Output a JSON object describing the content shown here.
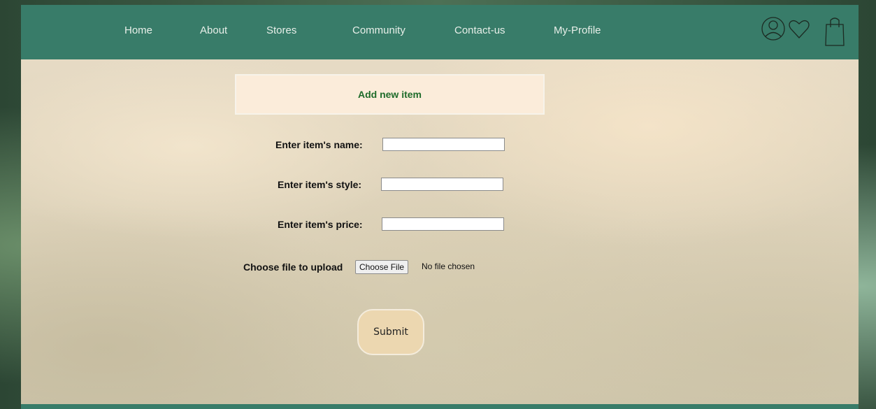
{
  "nav": {
    "links": [
      {
        "label": "Home"
      },
      {
        "label": "About"
      },
      {
        "label": "Stores"
      },
      {
        "label": "Community"
      },
      {
        "label": "Contact-us"
      },
      {
        "label": "My-Profile"
      }
    ],
    "icons": [
      "user-icon",
      "heart-icon",
      "shopping-bag-icon"
    ]
  },
  "form": {
    "heading": "Add new item",
    "name_label": "Enter item's name:",
    "name_value": "",
    "style_label": "Enter item's style:",
    "style_value": "",
    "price_label": "Enter item's price:",
    "price_value": "",
    "file_label": "Choose file to upload",
    "file_button": "Choose File",
    "file_status": "No file chosen",
    "submit_label": "Submit"
  },
  "colors": {
    "navbar": "#387c69",
    "heading_text": "#1e6b2a",
    "banner_bg": "#fbecda",
    "submit_bg": "#ecd7b0"
  }
}
